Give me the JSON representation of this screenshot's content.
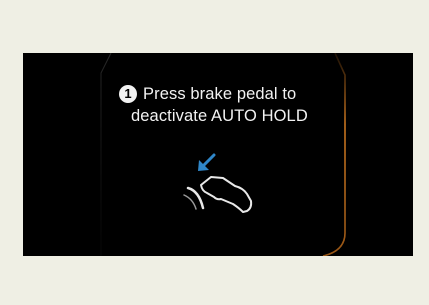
{
  "display": {
    "step_number": "1",
    "message_line1": "Press brake pedal to",
    "message_line2": "deactivate AUTO HOLD"
  },
  "icons": {
    "pedal": "brake-pedal-foot-icon",
    "arrow": "press-down-arrow-icon"
  },
  "colors": {
    "background": "#efefe4",
    "screen": "#000000",
    "accent_frame": "#b86a1c",
    "arrow": "#2f86c8",
    "text": "#f2f2f2"
  }
}
